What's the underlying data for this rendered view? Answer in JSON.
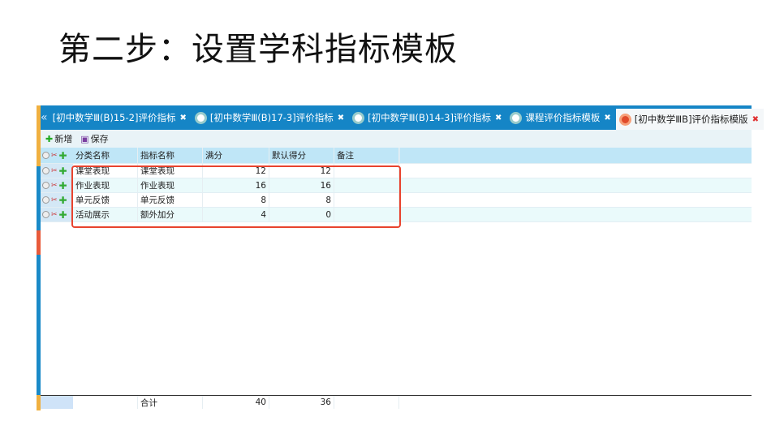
{
  "title": "第二步：设置学科指标模板",
  "tabs": [
    {
      "label": "[初中数学Ⅲ(B)15-2]评价指标",
      "active": false
    },
    {
      "label": "[初中数学Ⅲ(B)17-3]评价指标",
      "active": false
    },
    {
      "label": "[初中数学Ⅲ(B)14-3]评价指标",
      "active": false
    },
    {
      "label": "课程评价指标模板",
      "active": false
    },
    {
      "label": "[初中数学ⅢB]评价指标模版",
      "active": true
    }
  ],
  "toolbar": {
    "add": "新增",
    "save": "保存"
  },
  "columns": [
    "分类名称",
    "指标名称",
    "满分",
    "默认得分",
    "备注"
  ],
  "rows": [
    {
      "category": "课堂表现",
      "name": "课堂表现",
      "full": "12",
      "default": "12",
      "note": ""
    },
    {
      "category": "作业表现",
      "name": "作业表现",
      "full": "16",
      "default": "16",
      "note": ""
    },
    {
      "category": "单元反馈",
      "name": "单元反馈",
      "full": "8",
      "default": "8",
      "note": ""
    },
    {
      "category": "活动展示",
      "name": "额外加分",
      "full": "4",
      "default": "0",
      "note": ""
    }
  ],
  "footer": {
    "label": "合计",
    "full": "40",
    "default": "36"
  },
  "colors": {
    "tabbar": "#1585c6",
    "header": "#bfe6f7",
    "highlight": "#e8432e"
  }
}
